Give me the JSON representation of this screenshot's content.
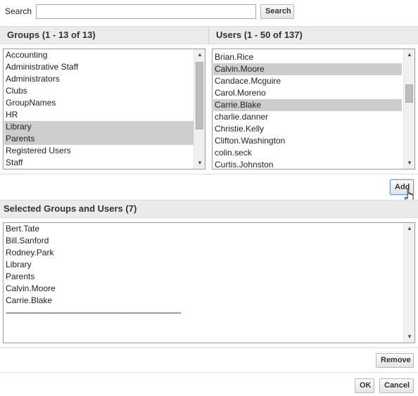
{
  "search": {
    "label": "Search",
    "value": "",
    "placeholder": "",
    "button_label": "Search"
  },
  "groups": {
    "header": "Groups (1 - 13 of 13)",
    "items": [
      {
        "label": "Accounting",
        "selected": false
      },
      {
        "label": "Administrative Staff",
        "selected": false
      },
      {
        "label": "Administrators",
        "selected": false
      },
      {
        "label": "Clubs",
        "selected": false
      },
      {
        "label": "GroupNames",
        "selected": false
      },
      {
        "label": "HR",
        "selected": false
      },
      {
        "label": "Library",
        "selected": true
      },
      {
        "label": "Parents",
        "selected": true
      },
      {
        "label": "Registered Users",
        "selected": false
      },
      {
        "label": "Staff",
        "selected": false
      }
    ]
  },
  "users": {
    "header": "Users (1 - 50 of 137)",
    "items": [
      {
        "label": "Brian.Rice",
        "selected": false
      },
      {
        "label": "Calvin.Moore",
        "selected": true
      },
      {
        "label": "Candace.Mcguire",
        "selected": false
      },
      {
        "label": "Carol.Moreno",
        "selected": false
      },
      {
        "label": "Carrie.Blake",
        "selected": true
      },
      {
        "label": "charlie.danner",
        "selected": false
      },
      {
        "label": "Christie.Kelly",
        "selected": false
      },
      {
        "label": "Clifton.Washington",
        "selected": false
      },
      {
        "label": "colin.seck",
        "selected": false
      },
      {
        "label": "Curtis.Johnston",
        "selected": false
      }
    ]
  },
  "add_button_label": "Add",
  "selected": {
    "header": "Selected Groups and Users (7)",
    "items": [
      "Bert.Tate",
      "Bill.Sanford",
      "Rodney.Park",
      "Library",
      "Parents",
      "Calvin.Moore",
      "Carrie.Blake"
    ],
    "divider": "-----------------------------------------------------------------------------------"
  },
  "footer": {
    "remove_label": "Remove",
    "ok_label": "OK",
    "cancel_label": "Cancel"
  },
  "icons": {
    "scroll_up": "scroll-up-arrow-icon",
    "scroll_down": "scroll-down-arrow-icon",
    "cursor": "hand-pointer-icon"
  },
  "colors": {
    "selection": "#cdcdcd",
    "header_band": "#ebebeb",
    "add_focus": "#6b9fd3"
  }
}
